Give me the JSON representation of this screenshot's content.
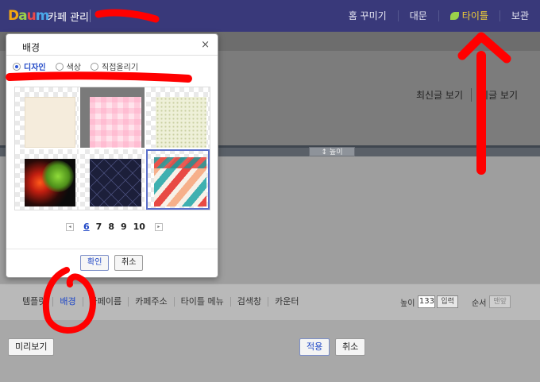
{
  "topbar": {
    "logo": {
      "d": "D",
      "a": "a",
      "u": "u",
      "m": "m"
    },
    "title": "카페 관리",
    "nav": [
      {
        "label": "홈 꾸미기",
        "active": false
      },
      {
        "label": "대문",
        "active": false
      },
      {
        "label": "타이틀",
        "active": true
      },
      {
        "label": "보관",
        "active": false
      }
    ]
  },
  "preview": {
    "links": [
      "최신글 보기",
      "기글 보기"
    ],
    "height_handle": "↕ 높이"
  },
  "dialog": {
    "title": "배경",
    "close": "×",
    "radios": [
      {
        "label": "디자인",
        "checked": true
      },
      {
        "label": "색상",
        "checked": false
      },
      {
        "label": "직접올리기",
        "checked": false
      }
    ],
    "thumbnails": [
      "beige-paper",
      "pink-check",
      "green-dots",
      "bokeh-lights",
      "navy-diamond",
      "diagonal-stripes"
    ],
    "selected_thumbnail": "diagonal-stripes",
    "pager": {
      "prev": "◂",
      "pages": [
        "6",
        "7",
        "8",
        "9",
        "10"
      ],
      "current": "6",
      "next": "▸"
    },
    "ok": "확인",
    "cancel": "취소"
  },
  "toolbar": {
    "tabs": [
      "템플릿",
      "배경",
      "카페이름",
      "카페주소",
      "타이틀 메뉴",
      "검색창",
      "카운터"
    ],
    "selected_tab": "배경",
    "height_label": "높이",
    "height_value": "133",
    "height_button": "입력",
    "order_label": "순서",
    "order_button": "맨앞"
  },
  "footer": {
    "preview": "미리보기",
    "apply": "적용",
    "cancel": "취소"
  },
  "colors": {
    "topbar": "#39397a",
    "accent": "#1f47c6",
    "annotation": "#ff0000",
    "active_nav": "#f3d036"
  }
}
